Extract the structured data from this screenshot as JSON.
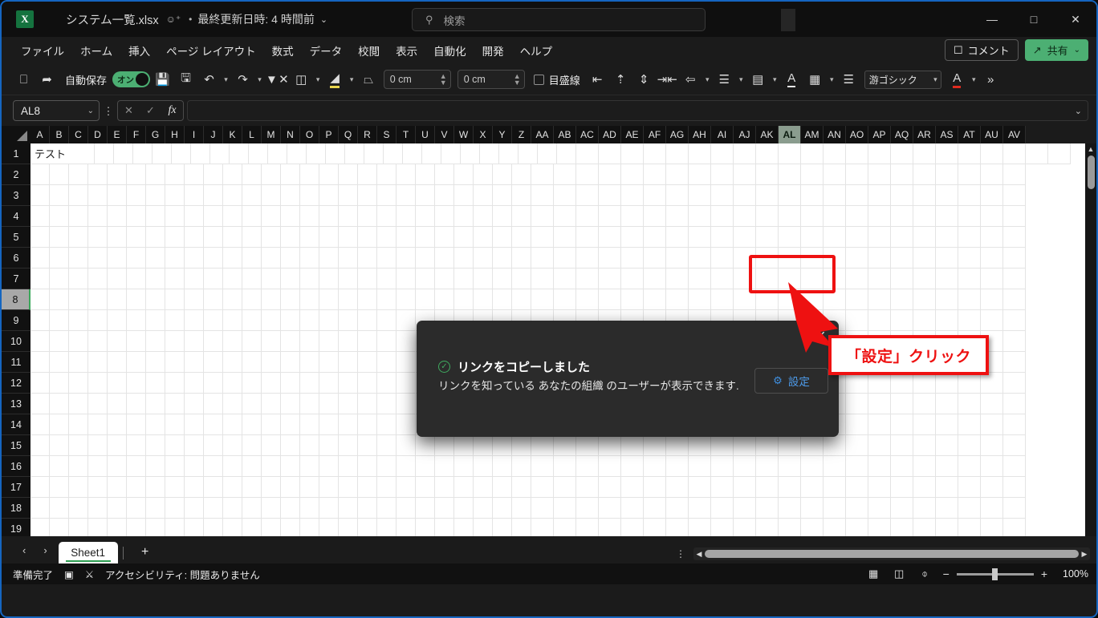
{
  "window": {
    "app_logo": "excel-logo",
    "doc_title": "システム一覧.xlsx",
    "people_icon": "person-icon",
    "separator": "•",
    "save_state": "最終更新日時: 4 時間前",
    "state_chevron": "⌄",
    "minimize": "—",
    "maximize": "□",
    "close": "✕"
  },
  "search": {
    "icon": "search-icon",
    "placeholder": "検索"
  },
  "ribbon": {
    "tabs": [
      {
        "label": "ファイル"
      },
      {
        "label": "ホーム"
      },
      {
        "label": "挿入"
      },
      {
        "label": "ページ レイアウト"
      },
      {
        "label": "数式"
      },
      {
        "label": "データ"
      },
      {
        "label": "校閲"
      },
      {
        "label": "表示"
      },
      {
        "label": "自動化"
      },
      {
        "label": "開発"
      },
      {
        "label": "ヘルプ"
      }
    ],
    "comment_label": "コメント",
    "comment_icon": "comment-icon",
    "share_label": "共有",
    "share_icon": "share-icon",
    "share_chevron": "⌄",
    "share_color": "#4caf73"
  },
  "toolbar": {
    "present_icon": "present-screen-icon",
    "pointer_icon": "pointer-icon",
    "autosave_label": "自動保存",
    "autosave_state": "オン",
    "autosave_on_color": "#4caf73",
    "save_icon": "save-refresh-icon",
    "saveas_icon": "save-edit-icon",
    "undo_icon": "↶",
    "redo_icon": "↷",
    "filter_icon": "clear-filter-icon",
    "shape_icon": "shape-icon",
    "fill_icon": "fill-color-icon",
    "crop_icon": "crop-icon",
    "height_value": "0 cm",
    "width_value": "0 cm",
    "gridline_label": "目盛線",
    "align_left_icon": "align-left-icon",
    "align_top_icon": "align-top-icon",
    "align_center_icon": "align-center-icon",
    "distribute_icon": "distribute-icon",
    "align_menu_icon": "align-menu-icon",
    "borders_icon": "borders-icon",
    "columns_icon": "columns-icon",
    "font_color_icon": "font-color-underline-icon",
    "cell_styles_icon": "cell-styles-icon",
    "list_icon": "list-icon",
    "font_name": "游ゴシック",
    "font_color_red_icon": "font-color-red-icon",
    "overflow_label": "»"
  },
  "formula_bar": {
    "name_box": "AL8",
    "name_chevron": "⌄",
    "more_icon": "more-vertical-icon",
    "cancel_icon": "✕",
    "enter_icon": "✓",
    "fx_icon": "fx",
    "formula_value": "",
    "expand_chevron": "⌄"
  },
  "grid": {
    "columns": [
      "A",
      "B",
      "C",
      "D",
      "E",
      "F",
      "G",
      "H",
      "I",
      "J",
      "K",
      "L",
      "M",
      "N",
      "O",
      "P",
      "Q",
      "R",
      "S",
      "T",
      "U",
      "V",
      "W",
      "X",
      "Y",
      "Z",
      "AA",
      "AB",
      "AC",
      "AD",
      "AE",
      "AF",
      "AG",
      "AH",
      "AI",
      "AJ",
      "AK",
      "AL",
      "AM",
      "AN",
      "AO",
      "AP",
      "AQ",
      "AR",
      "AS",
      "AT",
      "AU",
      "AV"
    ],
    "selected_column": "AL",
    "rows": [
      "1",
      "2",
      "3",
      "4",
      "5",
      "6",
      "7",
      "8",
      "9",
      "10",
      "11",
      "12",
      "13",
      "14",
      "15",
      "16",
      "17",
      "18",
      "19"
    ],
    "selected_row": "8",
    "cells": [
      {
        "row": "1",
        "col": "A",
        "value": "テスト"
      }
    ]
  },
  "dialog": {
    "close_icon": "✕",
    "status_icon": "check-circle-icon",
    "title": "リンクをコピーしました",
    "body": "リンクを知っている あなたの組織 のユーザーが表示できます.",
    "settings_icon": "gear-icon",
    "settings_label": "設定",
    "settings_link_color": "#4d9ae8"
  },
  "annotation": {
    "callout_text": "「設定」クリック",
    "highlight_color": "#ee1111"
  },
  "sheetbar": {
    "prev_icon": "‹",
    "next_icon": "›",
    "tabs": [
      {
        "label": "Sheet1",
        "active": true
      }
    ],
    "add_label": "+",
    "more_icon": "more-vertical-icon",
    "scroll_left": "◀",
    "scroll_right": "▶"
  },
  "statusbar": {
    "state": "準備完了",
    "record_icon": "macro-record-icon",
    "accessibility_icon": "accessibility-icon",
    "accessibility_text": "アクセシビリティ: 問題ありません",
    "view_normal_icon": "normal-view-icon",
    "view_layout_icon": "page-layout-view-icon",
    "view_break_icon": "page-break-view-icon",
    "zoom_out": "−",
    "zoom_in": "+",
    "zoom_value": "100%"
  }
}
